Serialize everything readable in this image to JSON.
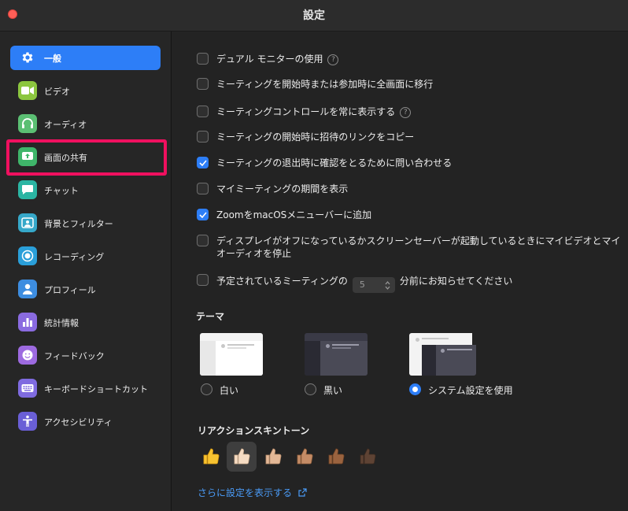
{
  "window": {
    "title": "設定"
  },
  "sidebar": {
    "items": [
      {
        "label": "一般",
        "icon": "gear-icon",
        "color": "#2d7ef7",
        "active": true
      },
      {
        "label": "ビデオ",
        "icon": "video-camera-icon",
        "color": "#8cc63f"
      },
      {
        "label": "オーディオ",
        "icon": "headphones-icon",
        "color": "#5bbf73"
      },
      {
        "label": "画面の共有",
        "icon": "share-screen-icon",
        "color": "#3fb56a"
      },
      {
        "label": "チャット",
        "icon": "chat-bubble-icon",
        "color": "#2bb5a3"
      },
      {
        "label": "背景とフィルター",
        "icon": "background-person-icon",
        "color": "#36a8c9"
      },
      {
        "label": "レコーディング",
        "icon": "record-icon",
        "color": "#2a9fd9"
      },
      {
        "label": "プロフィール",
        "icon": "profile-icon",
        "color": "#3d8de0"
      },
      {
        "label": "統計情報",
        "icon": "statistics-icon",
        "color": "#8a6be0"
      },
      {
        "label": "フィードバック",
        "icon": "smiley-icon",
        "color": "#9d6ae0"
      },
      {
        "label": "キーボードショートカット",
        "icon": "keyboard-icon",
        "color": "#7f6be0"
      },
      {
        "label": "アクセシビリティ",
        "icon": "accessibility-icon",
        "color": "#6a5fd6"
      }
    ]
  },
  "options": [
    {
      "label": "デュアル モニターの使用",
      "checked": false,
      "help": true
    },
    {
      "label": "ミーティングを開始時または参加時に全画面に移行",
      "checked": false
    },
    {
      "label": "ミーティングコントロールを常に表示する",
      "checked": false,
      "help": true
    },
    {
      "label": "ミーティングの開始時に招待のリンクをコピー",
      "checked": false
    },
    {
      "label": "ミーティングの退出時に確認をとるために問い合わせる",
      "checked": true
    },
    {
      "label": "マイミーティングの期間を表示",
      "checked": false
    },
    {
      "label": "ZoomをmacOSメニューバーに追加",
      "checked": true
    },
    {
      "label": "ディスプレイがオフになっているかスクリーンセーバーが起動しているときにマイビデオとマイ",
      "label_line2": "オーディオを停止",
      "checked": false
    }
  ],
  "reminder": {
    "prefix": "予定されているミーティングの",
    "value": "5",
    "suffix": "分前にお知らせてください",
    "checked": false
  },
  "theme": {
    "title": "テーマ",
    "choices": [
      {
        "label": "白い",
        "selected": false
      },
      {
        "label": "黒い",
        "selected": false
      },
      {
        "label": "システム設定を使用",
        "selected": true
      }
    ]
  },
  "reaction": {
    "title": "リアクションスキントーン",
    "tones": [
      {
        "emoji": "👍",
        "color": "#f7c331",
        "selected": false
      },
      {
        "emoji": "👍🏻",
        "color": "#f6dcc3",
        "selected": true
      },
      {
        "emoji": "👍🏼",
        "color": "#e3b897",
        "selected": false
      },
      {
        "emoji": "👍🏽",
        "color": "#c48c66",
        "selected": false
      },
      {
        "emoji": "👍🏾",
        "color": "#9a633f",
        "selected": false
      },
      {
        "emoji": "👍🏿",
        "color": "#5e4334",
        "selected": false
      }
    ]
  },
  "more_settings": {
    "label": "さらに設定を表示する",
    "icon": "external-link-icon"
  }
}
